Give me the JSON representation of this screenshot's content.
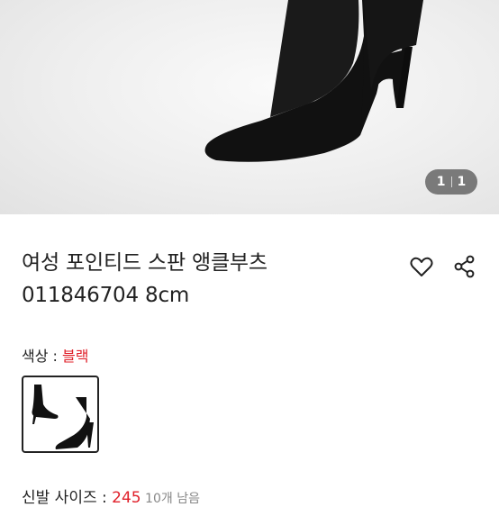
{
  "gallery": {
    "current": "1",
    "total": "1"
  },
  "product": {
    "name": "여성 포인티드 스판 앵클부츠",
    "code": "011846704 8cm"
  },
  "options": {
    "color_label": "색상 : ",
    "color_value": "블랙",
    "size_label": "신발 사이즈 : ",
    "size_value": "245",
    "stock_text": " 10개 남음"
  },
  "colors": {
    "accent_red": "#e0202a",
    "text": "#222222"
  },
  "icons": {
    "wishlist": "heart-icon",
    "share": "share-icon"
  }
}
